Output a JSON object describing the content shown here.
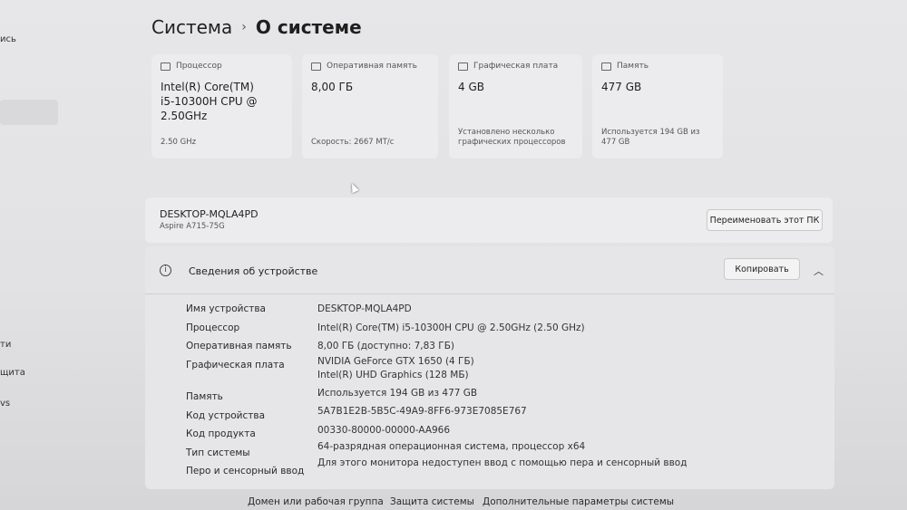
{
  "sidebar": {
    "fragments": [
      "ись",
      "ти",
      "щита",
      "vs"
    ]
  },
  "breadcrumb": {
    "parent": "Система",
    "separator": "›",
    "current": "О системе"
  },
  "cards": [
    {
      "label": "Процессор",
      "value": "Intel(R) Core(TM) i5-10300H CPU @ 2.50GHz",
      "sub": "2.50 GHz",
      "icon": "cpu-icon"
    },
    {
      "label": "Оперативная память",
      "value": "8,00 ГБ",
      "sub": "Скорость: 2667 МТ/с",
      "icon": "ram-icon"
    },
    {
      "label": "Графическая плата",
      "value": "4 GB",
      "sub": "Установлено несколько графических процессоров",
      "icon": "gpu-icon"
    },
    {
      "label": "Память",
      "value": "477 GB",
      "sub": "Используется 194 GB из 477 GB",
      "icon": "storage-icon"
    }
  ],
  "device": {
    "name": "DESKTOP-MQLA4PD",
    "model": "Aspire A715-75G",
    "rename_label": "Переименовать этот ПК"
  },
  "info": {
    "title": "Сведения об устройстве",
    "copy_label": "Копировать",
    "rows": [
      {
        "key": "Имя устройства",
        "value": "DESKTOP-MQLA4PD"
      },
      {
        "key": "Процессор",
        "value": "Intel(R) Core(TM) i5-10300H CPU @ 2.50GHz (2.50 GHz)"
      },
      {
        "key": "Оперативная память",
        "value": "8,00 ГБ (доступно: 7,83 ГБ)"
      },
      {
        "key": "Графическая плата",
        "value": "NVIDIA GeForce GTX 1650 (4 ГБ)",
        "value2": "Intel(R) UHD Graphics (128 МБ)"
      },
      {
        "key": "Память",
        "value": "Используется 194 GB из 477 GB"
      },
      {
        "key": "Код устройства",
        "value": "5A7B1E2B-5B5C-49A9-8FF6-973E7085E767"
      },
      {
        "key": "Код продукта",
        "value": "00330-80000-00000-AA966"
      },
      {
        "key": "Тип системы",
        "value": "64-разрядная операционная система, процессор x64"
      },
      {
        "key": "Перо и сенсорный ввод",
        "value": "Для этого монитора недоступен ввод с помощью пера и сенсорный ввод"
      }
    ]
  },
  "footer": {
    "links": [
      "Домен или рабочая группа",
      "Защита системы",
      "Дополнительные параметры системы"
    ]
  }
}
